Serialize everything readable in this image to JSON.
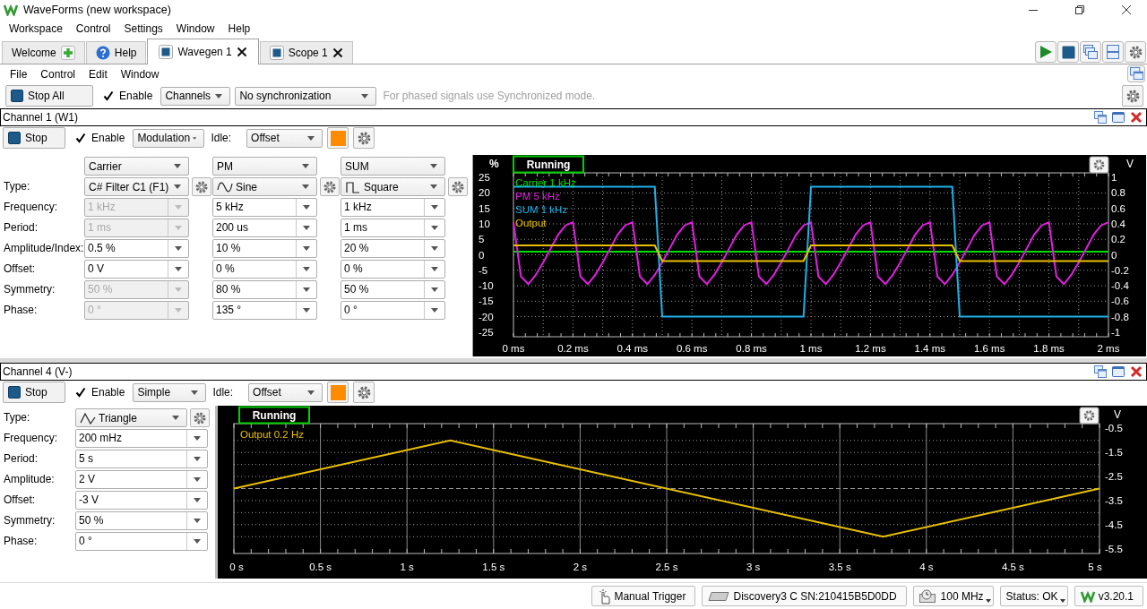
{
  "window": {
    "title": "WaveForms (new workspace)"
  },
  "menu": [
    "Workspace",
    "Control",
    "Settings",
    "Window",
    "Help"
  ],
  "tabs": [
    {
      "label": "Welcome",
      "kind": "add",
      "selected": false
    },
    {
      "label": "Help",
      "kind": "help",
      "selected": false
    },
    {
      "label": "Wavegen 1",
      "kind": "instrument",
      "selected": true
    },
    {
      "label": "Scope 1",
      "kind": "instrument",
      "selected": false
    }
  ],
  "instrument_menu": [
    "File",
    "Control",
    "Edit",
    "Window"
  ],
  "toolbar": {
    "stop_all": "Stop All",
    "enable": {
      "label": "Enable",
      "checked": true
    },
    "channels": "Channels",
    "synchronization": "No synchronization",
    "hint": "For phased signals use Synchronized mode."
  },
  "channels": [
    {
      "kind": "modulation",
      "title": "Channel 1 (W1)",
      "stop": "Stop",
      "enable": {
        "label": "Enable",
        "checked": true
      },
      "mode": "Modulation",
      "idle_label": "Idle:",
      "idle": "Offset",
      "color": "#ff8c00",
      "row_labels": [
        "Type:",
        "Frequency:",
        "Period:",
        "Amplitude/Index:",
        "Offset:",
        "Symmetry:",
        "Phase:"
      ],
      "components": [
        {
          "role": "Carrier",
          "type": {
            "label": "C# Filter C1 (F1)",
            "kind": "custom"
          },
          "fields": [
            {
              "value": "1 kHz",
              "disabled": true
            },
            {
              "value": "1 ms",
              "disabled": true
            },
            {
              "value": "0.5 %",
              "disabled": false
            },
            {
              "value": "0 V",
              "disabled": false
            },
            {
              "value": "50 %",
              "disabled": true
            },
            {
              "value": "0 °",
              "disabled": true
            }
          ]
        },
        {
          "role": "PM",
          "type": {
            "label": "Sine",
            "kind": "sine"
          },
          "fields": [
            {
              "value": "5 kHz",
              "disabled": false
            },
            {
              "value": "200 us",
              "disabled": false
            },
            {
              "value": "10 %",
              "disabled": false
            },
            {
              "value": "0 %",
              "disabled": false
            },
            {
              "value": "80 %",
              "disabled": false
            },
            {
              "value": "135 °",
              "disabled": false
            }
          ]
        },
        {
          "role": "SUM",
          "type": {
            "label": "Square",
            "kind": "square"
          },
          "fields": [
            {
              "value": "1 kHz",
              "disabled": false
            },
            {
              "value": "1 ms",
              "disabled": false
            },
            {
              "value": "20 %",
              "disabled": false
            },
            {
              "value": "0 %",
              "disabled": false
            },
            {
              "value": "50 %",
              "disabled": false
            },
            {
              "value": "0 °",
              "disabled": false
            }
          ]
        }
      ],
      "scope": {
        "status": "Running",
        "right_axis": {
          "unit": "V",
          "labels": [
            "1",
            "0.8",
            "0.6",
            "0.4",
            "0.2",
            "0",
            "-0.2",
            "-0.4",
            "-0.6",
            "-0.8",
            "-1"
          ]
        },
        "chart_data": {
          "type": "line",
          "ylabel": "%",
          "x": [
            0,
            0.025,
            0.05,
            0.075,
            0.1,
            0.125,
            0.15,
            0.175,
            0.2,
            0.225,
            0.25,
            0.275,
            0.3,
            0.325,
            0.35,
            0.375,
            0.4,
            0.425,
            0.45,
            0.475,
            0.5,
            0.525,
            0.55,
            0.575,
            0.6,
            0.625,
            0.65,
            0.675,
            0.7,
            0.725,
            0.75,
            0.775,
            0.8,
            0.825,
            0.85,
            0.875,
            0.9,
            0.925,
            0.95,
            0.975,
            1,
            1.025,
            1.05,
            1.075,
            1.1,
            1.125,
            1.15,
            1.175,
            1.2,
            1.225,
            1.25,
            1.275,
            1.3,
            1.325,
            1.35,
            1.375,
            1.4,
            1.425,
            1.45,
            1.475,
            1.5,
            1.525,
            1.55,
            1.575,
            1.6,
            1.625,
            1.65,
            1.675,
            1.7,
            1.725,
            1.75,
            1.775,
            1.8,
            1.825,
            1.85,
            1.875,
            1.9,
            1.925,
            1.95,
            1.975,
            2
          ],
          "series": [
            {
              "name": "Carrier 1 kHz",
              "color": "#00e000",
              "values": [
                1,
                1,
                1,
                1,
                1,
                1,
                1,
                1,
                1,
                1,
                1,
                1,
                1,
                1,
                1,
                1,
                1,
                1,
                1,
                1,
                1,
                1,
                1,
                1,
                1,
                1,
                1,
                1,
                1,
                1,
                1,
                1,
                1,
                1,
                1,
                1,
                1,
                1,
                1,
                1,
                1,
                1,
                1,
                1,
                1,
                1,
                1,
                1,
                1,
                1,
                1,
                1,
                1,
                1,
                1,
                1,
                1,
                1,
                1,
                1,
                1,
                1,
                1,
                1,
                1,
                1,
                1,
                1,
                1,
                1,
                1,
                1,
                1,
                1,
                1,
                1,
                1,
                1,
                1,
                1,
                1
              ]
            },
            {
              "name": "PM 5 kHz",
              "color": "#e020e0",
              "values": [
                10.5,
                -7,
                -9.5,
                -6.5,
                -2.5,
                2,
                6.5,
                9.5,
                10.5,
                -7,
                -9.5,
                -6.5,
                -2.5,
                2,
                6.5,
                9.5,
                10.5,
                -7,
                -9.5,
                -6.5,
                -2.5,
                2,
                6.5,
                9.5,
                10.5,
                -7,
                -9.5,
                -6.5,
                -2.5,
                2,
                6.5,
                9.5,
                10.5,
                -7,
                -9.5,
                -6.5,
                -2.5,
                2,
                6.5,
                9.5,
                10.5,
                -7,
                -9.5,
                -6.5,
                -2.5,
                2,
                6.5,
                9.5,
                10.5,
                -7,
                -9.5,
                -6.5,
                -2.5,
                2,
                6.5,
                9.5,
                10.5,
                -7,
                -9.5,
                -6.5,
                -2.5,
                2,
                6.5,
                9.5,
                10.5,
                -7,
                -9.5,
                -6.5,
                -2.5,
                2,
                6.5,
                9.5,
                10.5,
                -7,
                -9.5,
                -6.5,
                -2.5,
                2,
                6.5,
                9.5,
                10.5
              ]
            },
            {
              "name": "SUM 1 kHz",
              "color": "#20b0e8",
              "values": [
                22,
                22,
                22,
                22,
                22,
                22,
                22,
                22,
                22,
                22,
                22,
                22,
                22,
                22,
                22,
                22,
                22,
                22,
                22,
                22,
                -20,
                -20,
                -20,
                -20,
                -20,
                -20,
                -20,
                -20,
                -20,
                -20,
                -20,
                -20,
                -20,
                -20,
                -20,
                -20,
                -20,
                -20,
                -20,
                -20,
                22,
                22,
                22,
                22,
                22,
                22,
                22,
                22,
                22,
                22,
                22,
                22,
                22,
                22,
                22,
                22,
                22,
                22,
                22,
                22,
                -20,
                -20,
                -20,
                -20,
                -20,
                -20,
                -20,
                -20,
                -20,
                -20,
                -20,
                -20,
                -20,
                -20,
                -20,
                -20,
                -20,
                -20,
                -20,
                -20,
                -20
              ]
            },
            {
              "name": "Output",
              "color": "#e8c000",
              "values": [
                3,
                3,
                3,
                3,
                3,
                3,
                3,
                3,
                3,
                3,
                3,
                3,
                3,
                3,
                3,
                3,
                3,
                3,
                3,
                3,
                -2,
                -2,
                -2,
                -2,
                -2,
                -2,
                -2,
                -2,
                -2,
                -2,
                -2,
                -2,
                -2,
                -2,
                -2,
                -2,
                -2,
                -2,
                -2,
                -2,
                3,
                3,
                3,
                3,
                3,
                3,
                3,
                3,
                3,
                3,
                3,
                3,
                3,
                3,
                3,
                3,
                3,
                3,
                3,
                3,
                -2,
                -2,
                -2,
                -2,
                -2,
                -2,
                -2,
                -2,
                -2,
                -2,
                -2,
                -2,
                -2,
                -2,
                -2,
                -2,
                -2,
                -2,
                -2,
                -2,
                -2
              ]
            }
          ],
          "xlim": [
            0,
            2
          ],
          "ylim": [
            -26.5,
            26.5
          ],
          "grid": true,
          "xticks": [
            {
              "value": 0,
              "label": "0 ms"
            },
            {
              "value": 0.2,
              "label": "0.2 ms"
            },
            {
              "value": 0.4,
              "label": "0.4 ms"
            },
            {
              "value": 0.6,
              "label": "0.6 ms"
            },
            {
              "value": 0.8,
              "label": "0.8 ms"
            },
            {
              "value": 1,
              "label": "1 ms"
            },
            {
              "value": 1.2,
              "label": "1.2 ms"
            },
            {
              "value": 1.4,
              "label": "1.4 ms"
            },
            {
              "value": 1.6,
              "label": "1.6 ms"
            },
            {
              "value": 1.8,
              "label": "1.8 ms"
            },
            {
              "value": 2,
              "label": "2 ms"
            }
          ],
          "yticks": [
            25,
            20,
            15,
            10,
            5,
            0,
            -5,
            -10,
            -15,
            -20,
            -25
          ]
        }
      }
    },
    {
      "kind": "simple",
      "title": "Channel 4 (V-)",
      "stop": "Stop",
      "enable": {
        "label": "Enable",
        "checked": true
      },
      "mode": "Simple",
      "idle_label": "Idle:",
      "idle": "Offset",
      "color": "#ff8c00",
      "type": {
        "label_text": "Type:",
        "label": "Triangle",
        "kind": "triangle"
      },
      "rows": [
        {
          "label": "Frequency:",
          "value": "200 mHz"
        },
        {
          "label": "Period:",
          "value": "5 s"
        },
        {
          "label": "Amplitude:",
          "value": "2 V"
        },
        {
          "label": "Offset:",
          "value": "-3 V"
        },
        {
          "label": "Symmetry:",
          "value": "50 %"
        },
        {
          "label": "Phase:",
          "value": "0 °"
        }
      ],
      "scope": {
        "status": "Running",
        "chart_data": {
          "type": "line",
          "ylabel": "V",
          "x": [
            0,
            1.25,
            3.75,
            5
          ],
          "series": [
            {
              "name": "Output 0.2 Hz",
              "color": "#e8c000",
              "values": [
                -3,
                -1,
                -5,
                -3
              ]
            }
          ],
          "xlim": [
            0,
            5
          ],
          "ylim": [
            -5.7,
            -0.3
          ],
          "grid": true,
          "xticks": [
            {
              "value": 0,
              "label": "0 s"
            },
            {
              "value": 0.5,
              "label": "0.5 s"
            },
            {
              "value": 1,
              "label": "1 s"
            },
            {
              "value": 1.5,
              "label": "1.5 s"
            },
            {
              "value": 2,
              "label": "2 s"
            },
            {
              "value": 2.5,
              "label": "2.5 s"
            },
            {
              "value": 3,
              "label": "3 s"
            },
            {
              "value": 3.5,
              "label": "3.5 s"
            },
            {
              "value": 4,
              "label": "4 s"
            },
            {
              "value": 4.5,
              "label": "4.5 s"
            },
            {
              "value": 5,
              "label": "5 s"
            }
          ],
          "yticks": [
            -0.5,
            -1.5,
            -2.5,
            -3.5,
            -4.5,
            -5.5
          ]
        }
      }
    }
  ],
  "status_bar": [
    {
      "label": "Manual Trigger",
      "kind": "trigger"
    },
    {
      "label": "Discovery3 C SN:210415B5D0DD",
      "kind": "device"
    },
    {
      "label": "100 MHz",
      "kind": "clock"
    },
    {
      "label": "Status: OK",
      "kind": "status"
    },
    {
      "label": "v3.20.1",
      "kind": "version"
    }
  ]
}
